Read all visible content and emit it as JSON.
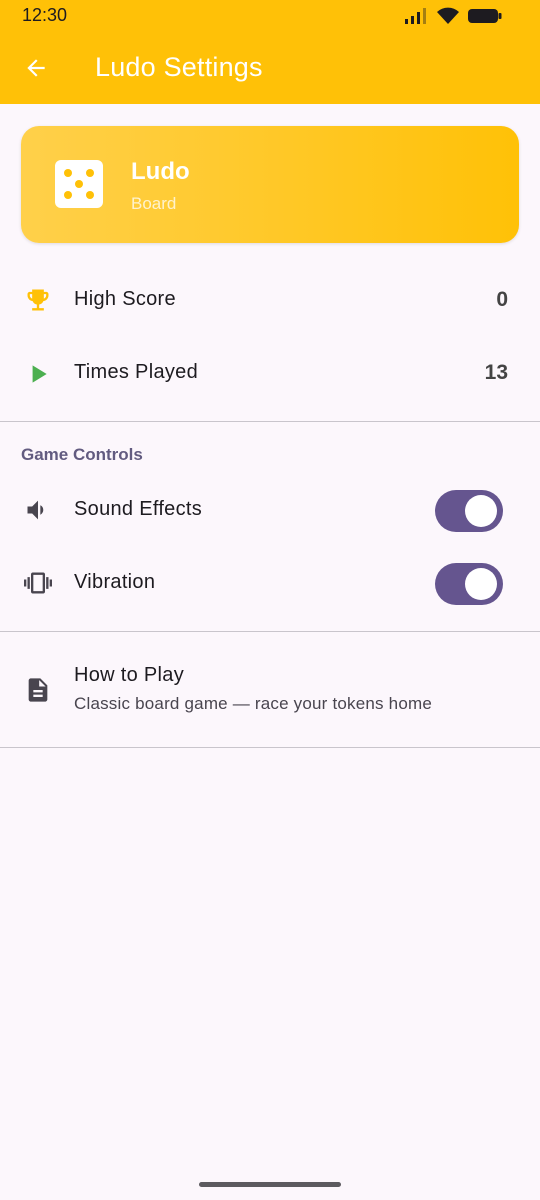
{
  "status_bar": {
    "time": "12:30"
  },
  "app_bar": {
    "title": "Ludo Settings",
    "back_icon": "arrow-back-icon"
  },
  "header_card": {
    "title": "Ludo",
    "subtitle": "Board",
    "icon": "dice-icon"
  },
  "stats": [
    {
      "label": "High Score",
      "value": "0",
      "icon": "trophy-icon"
    },
    {
      "label": "Times Played",
      "value": "13",
      "icon": "play-icon"
    }
  ],
  "game_controls": {
    "section_title": "Game Controls",
    "items": [
      {
        "label": "Sound Effects",
        "icon": "volume-icon",
        "enabled": true
      },
      {
        "label": "Vibration",
        "icon": "vibration-icon",
        "enabled": true
      }
    ]
  },
  "how_to_play": {
    "title": "How to Play",
    "description": "Classic board game — race your tokens home",
    "icon": "document-icon"
  },
  "colors": {
    "app_bar": "#ffc107",
    "accent": "#65558f",
    "background": "#fcf7fc",
    "trophy": "#ffc107",
    "play": "#4caf50"
  }
}
